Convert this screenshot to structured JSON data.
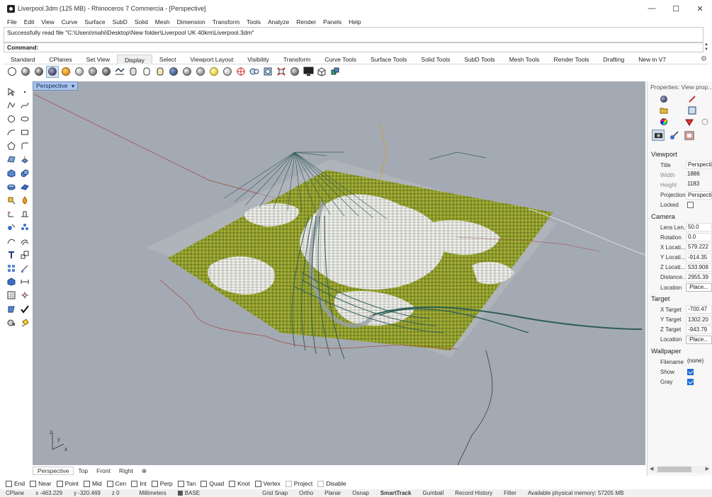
{
  "window": {
    "title": "Liverpool.3dm (125 MB) - Rhinoceros 7 Commercia - [Perspective]",
    "minimize": "—",
    "maximize": "☐",
    "close": "✕"
  },
  "menus": [
    "File",
    "Edit",
    "View",
    "Curve",
    "Surface",
    "SubD",
    "Solid",
    "Mesh",
    "Dimension",
    "Transform",
    "Tools",
    "Analyze",
    "Render",
    "Panels",
    "Help"
  ],
  "command": {
    "history": "Successfully read file \"C:\\Users\\mahi\\Desktop\\New folder\\Liverpool UK 40km\\Liverpool.3dm\"",
    "prompt": "Command:"
  },
  "toolbar_tabs": [
    "Standard",
    "CPlanes",
    "Set View",
    "Display",
    "Select",
    "Viewport Layout",
    "Visibility",
    "Transform",
    "Curve Tools",
    "Surface Tools",
    "Solid Tools",
    "SubD Tools",
    "Mesh Tools",
    "Render Tools",
    "Drafting",
    "New in V7"
  ],
  "active_tab": "Display",
  "viewport": {
    "name": "Perspective",
    "axis_x": "x",
    "axis_y": "y",
    "axis_z": "z"
  },
  "viewport_tabs": [
    "Perspective",
    "Top",
    "Front",
    "Right"
  ],
  "viewport_tab_add": "⊕",
  "properties": {
    "title": "Properties: View prop...",
    "viewport_section": "Viewport",
    "camera_section": "Camera",
    "target_section": "Target",
    "wallpaper_section": "Wallpaper",
    "title_label": "Title",
    "title_value": "Perspective",
    "width_label": "Width",
    "width_value": "1886",
    "height_label": "Height",
    "height_value": "1183",
    "projection_label": "Projection",
    "projection_value": "Perspective",
    "locked_label": "Locked",
    "lens_label": "Lens Len...",
    "lens_value": "50.0",
    "rotation_label": "Rotation",
    "rotation_value": "0.0",
    "xloc_label": "X Locati...",
    "xloc_value": "579.222",
    "yloc_label": "Y Locati...",
    "yloc_value": "-914.35",
    "zloc_label": "Z Locati...",
    "zloc_value": "533.908",
    "distance_label": "Distance...",
    "distance_value": "2955.39",
    "cam_location_label": "Location",
    "cam_location_button": "Place...",
    "xtarget_label": "X Target",
    "xtarget_value": "-700.47",
    "ytarget_label": "Y Target",
    "ytarget_value": "1302.20",
    "ztarget_label": "Z Target",
    "ztarget_value": "-943.79",
    "tgt_location_label": "Location",
    "tgt_location_button": "Place...",
    "filename_label": "Filename",
    "filename_value": "(none)",
    "show_label": "Show",
    "gray_label": "Gray"
  },
  "osnaps": [
    "End",
    "Near",
    "Point",
    "Mid",
    "Cen",
    "Int",
    "Perp",
    "Tan",
    "Quad",
    "Knot",
    "Vertex",
    "Project",
    "Disable"
  ],
  "status": {
    "cplane": "CPlane",
    "x": "x -463.229",
    "y": "y -320.469",
    "z": "z 0",
    "units": "Millimeters",
    "layer": "BASE",
    "grid_snap": "Grid Snap",
    "ortho": "Ortho",
    "planar": "Planar",
    "osnap": "Osnap",
    "smarttrack": "SmartTrack",
    "gumball": "Gumball",
    "record_history": "Record History",
    "filter": "Filter",
    "memory": "Available physical memory: 57205 MB"
  },
  "colors": {
    "viewport_bg": "#a4aab3",
    "terrain_green": "#8a9a2e",
    "building_white": "#e8e8e4",
    "road_teal": "#2f5d58",
    "boundary_red": "#a0504a",
    "accent_blue": "#1d6ed8"
  }
}
